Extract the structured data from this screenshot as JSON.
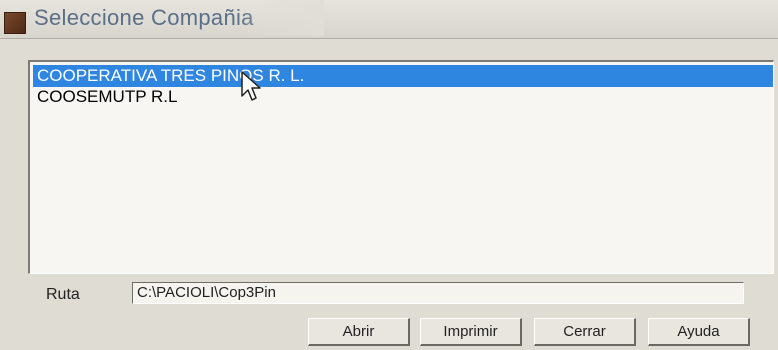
{
  "window": {
    "title": "Seleccione Compañia"
  },
  "companies": {
    "items": [
      {
        "label": "COOPERATIVA TRES PINOS R. L.",
        "selected": true
      },
      {
        "label": "COOSEMUTP R.L",
        "selected": false
      }
    ]
  },
  "ruta": {
    "label": "Ruta",
    "value": "C:\\PACIOLI\\Cop3Pin"
  },
  "buttons": {
    "abrir": "Abrir",
    "imprimir": "Imprimir",
    "cerrar": "Cerrar",
    "ayuda": "Ayuda"
  },
  "colors": {
    "selection": "#2f86e0",
    "dialog_bg": "#dedcd3"
  },
  "icons": {
    "app": "app-icon",
    "cursor": "mouse-pointer-icon"
  }
}
